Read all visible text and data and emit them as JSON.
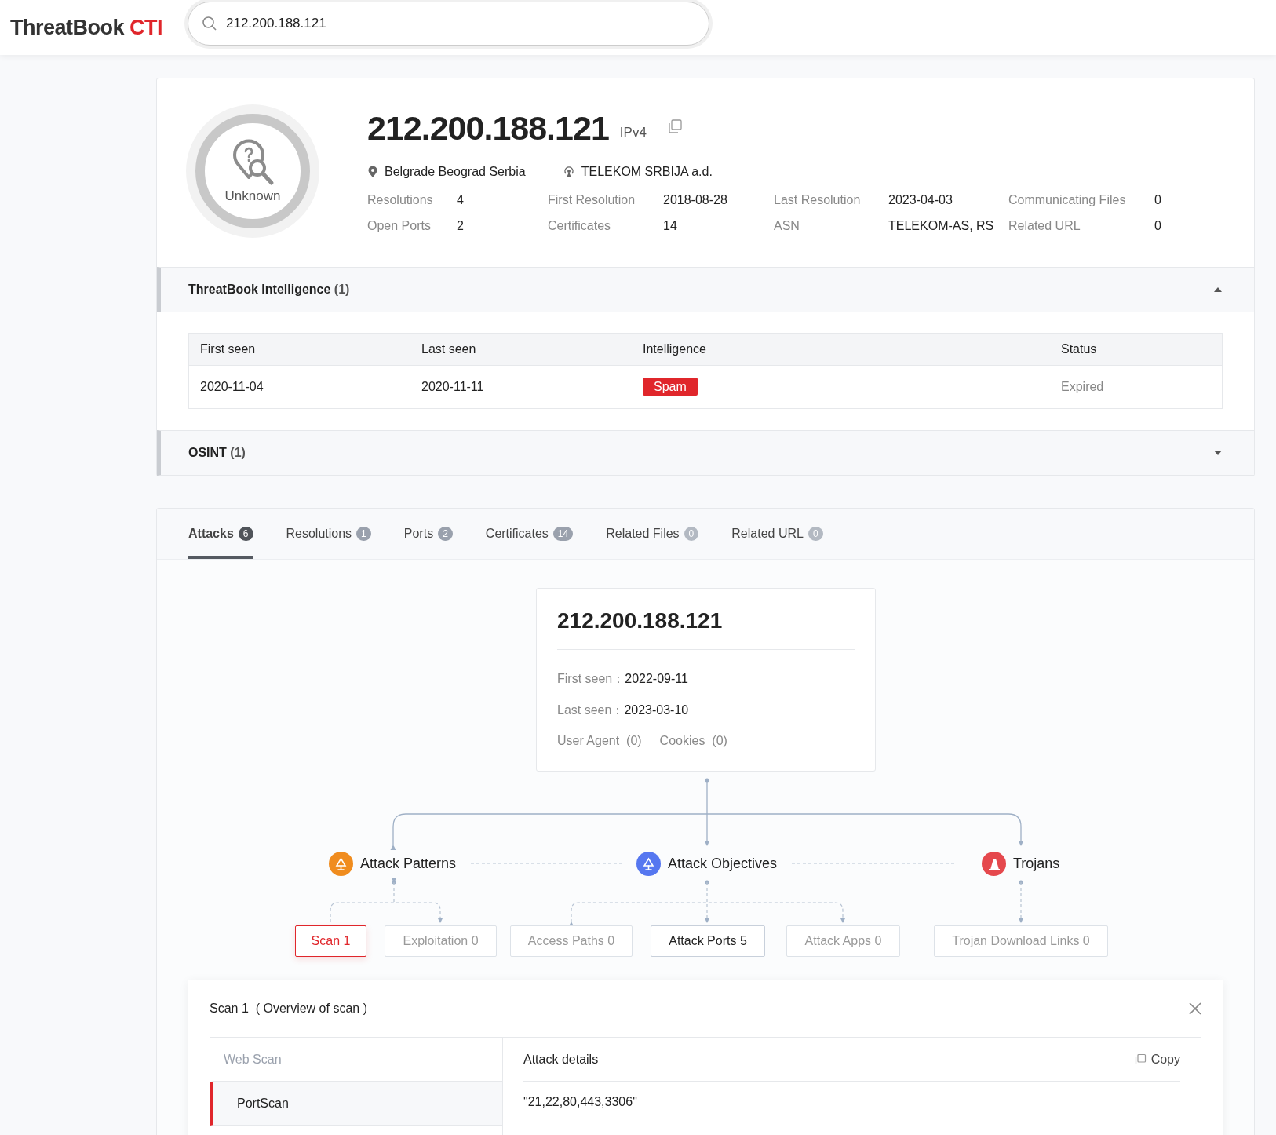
{
  "header": {
    "logo": {
      "brand": "ThreatBook",
      "product": "CTI"
    },
    "search": {
      "value": "212.200.188.121"
    }
  },
  "profile": {
    "verdict": "Unknown",
    "ip": "212.200.188.121",
    "ip_type": "IPv4",
    "location": "Belgrade Beograd Serbia",
    "isp": "TELEKOM SRBIJA a.d.",
    "stats": [
      {
        "label": "Resolutions",
        "value": "4"
      },
      {
        "label": "First Resolution",
        "value": "2018-08-28"
      },
      {
        "label": "Last Resolution",
        "value": "2023-04-03"
      },
      {
        "label": "Communicating Files",
        "value": "0"
      },
      {
        "label": "Open Ports",
        "value": "2"
      },
      {
        "label": "Certificates",
        "value": "14"
      },
      {
        "label": "ASN",
        "value": "TELEKOM-AS, RS"
      },
      {
        "label": "Related URL",
        "value": "0"
      }
    ]
  },
  "sections": [
    {
      "title": "ThreatBook Intelligence",
      "count": "(1)",
      "expanded": true,
      "table": {
        "columns": [
          "First seen",
          "Last seen",
          "Intelligence",
          "Status"
        ],
        "rows": [
          {
            "first_seen": "2020-11-04",
            "last_seen": "2020-11-11",
            "tag": "Spam",
            "status": "Expired"
          }
        ]
      }
    },
    {
      "title": "OSINT",
      "count": "(1)",
      "expanded": false
    }
  ],
  "tabs": [
    {
      "label": "Attacks",
      "count": "6",
      "selected": true,
      "disabled": false
    },
    {
      "label": "Resolutions",
      "count": "1",
      "selected": false,
      "disabled": false
    },
    {
      "label": "Ports",
      "count": "2",
      "selected": false,
      "disabled": false
    },
    {
      "label": "Certificates",
      "count": "14",
      "selected": false,
      "disabled": false
    },
    {
      "label": "Related Files",
      "count": "0",
      "selected": false,
      "disabled": true
    },
    {
      "label": "Related URL",
      "count": "0",
      "selected": false,
      "disabled": true
    }
  ],
  "attack_graph": {
    "ip": "212.200.188.121",
    "details": [
      {
        "label": "First seen：",
        "value": "2022-09-11"
      },
      {
        "label": "Last seen：",
        "value": "2023-03-10"
      }
    ],
    "extras": [
      {
        "label": "User Agent",
        "count": "(0)"
      },
      {
        "label": "Cookies",
        "count": "(0)"
      }
    ],
    "categories": [
      {
        "kind": "patterns",
        "label": "Attack Patterns",
        "color": "#f08c1e"
      },
      {
        "kind": "objectives",
        "label": "Attack Objectives",
        "color": "#5677f0"
      },
      {
        "kind": "trojans",
        "label": "Trojans",
        "color": "#e5484d"
      }
    ],
    "items": [
      {
        "label": "Scan 1",
        "selected": true,
        "disabled": false
      },
      {
        "label": "Exploitation 0",
        "selected": false,
        "disabled": true
      },
      {
        "label": "Access Paths 0",
        "selected": false,
        "disabled": true
      },
      {
        "label": "Attack Ports 5",
        "selected": false,
        "disabled": false
      },
      {
        "label": "Attack Apps 0",
        "selected": false,
        "disabled": true
      },
      {
        "label": "Trojan Download Links 0",
        "selected": false,
        "disabled": true
      }
    ]
  },
  "detail_panel": {
    "title": "Scan 1",
    "subtitle": "( Overview of scan )",
    "groups": [
      {
        "label": "Web Scan",
        "kind": "heading",
        "selected": false
      },
      {
        "label": "PortScan",
        "kind": "item",
        "selected": true
      }
    ],
    "details_title": "Attack details",
    "copy_label": "Copy",
    "details_value": "\"21,22,80,443,3306\""
  }
}
